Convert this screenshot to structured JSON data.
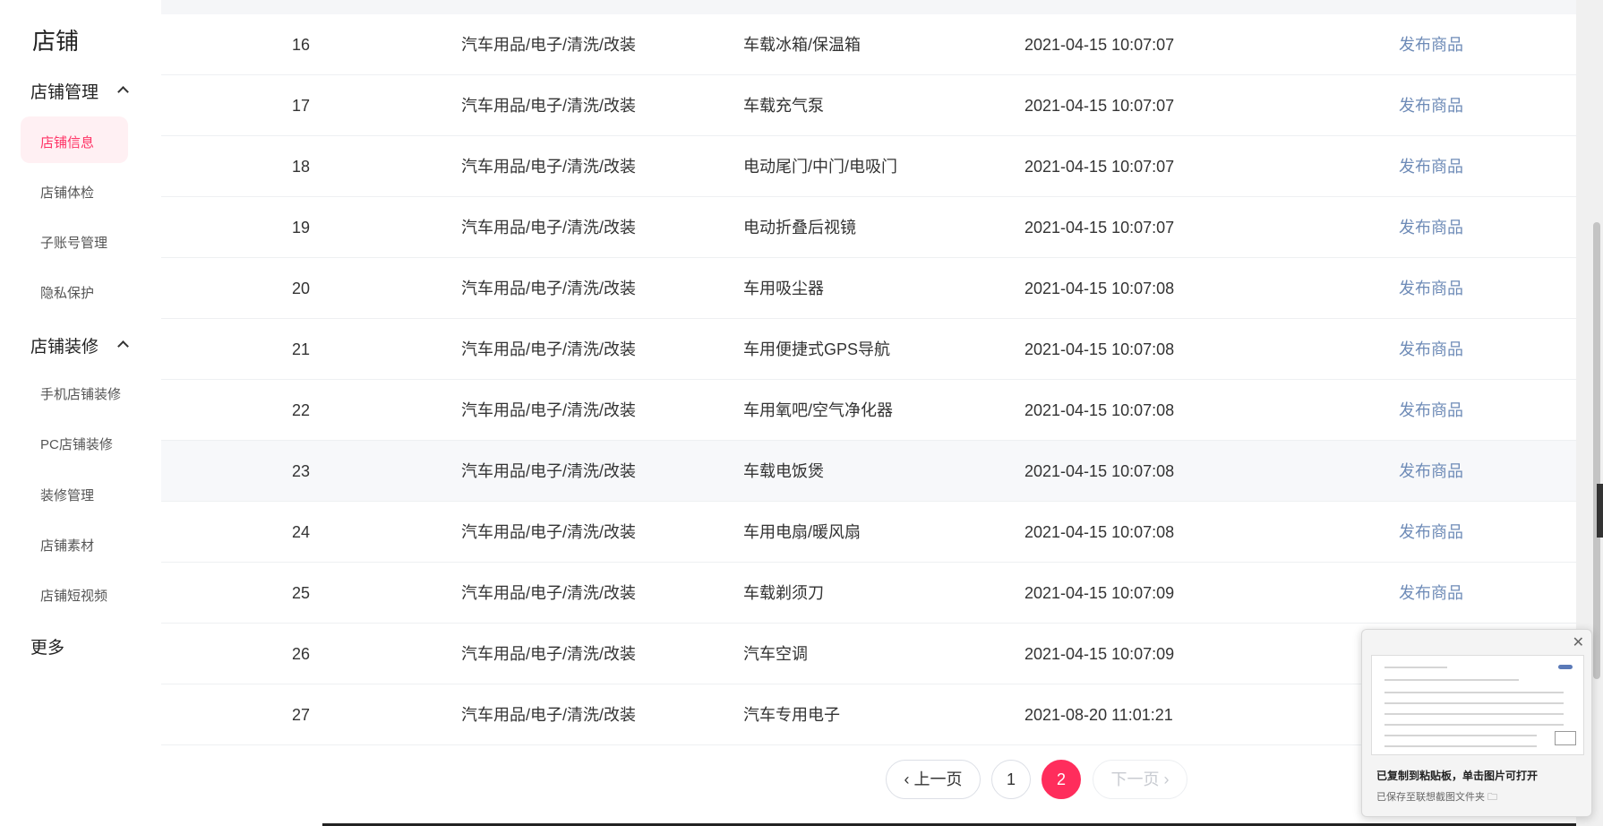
{
  "sidebar": {
    "brand": "店铺",
    "groups": [
      {
        "title": "店铺管理",
        "items": [
          "店铺信息",
          "店铺体检",
          "子账号管理",
          "隐私保护"
        ]
      },
      {
        "title": "店铺装修",
        "items": [
          "手机店铺装修",
          "PC店铺装修",
          "装修管理",
          "店铺素材",
          "店铺短视频"
        ]
      }
    ],
    "more": "更多",
    "active_item": "店铺信息"
  },
  "table": {
    "rows": [
      {
        "num": "16",
        "category": "汽车用品/电子/清洗/改装",
        "subcategory": "车载冰箱/保温箱",
        "time": "2021-04-15 10:07:07",
        "action": "发布商品"
      },
      {
        "num": "17",
        "category": "汽车用品/电子/清洗/改装",
        "subcategory": "车载充气泵",
        "time": "2021-04-15 10:07:07",
        "action": "发布商品"
      },
      {
        "num": "18",
        "category": "汽车用品/电子/清洗/改装",
        "subcategory": "电动尾门/中门/电吸门",
        "time": "2021-04-15 10:07:07",
        "action": "发布商品"
      },
      {
        "num": "19",
        "category": "汽车用品/电子/清洗/改装",
        "subcategory": "电动折叠后视镜",
        "time": "2021-04-15 10:07:07",
        "action": "发布商品"
      },
      {
        "num": "20",
        "category": "汽车用品/电子/清洗/改装",
        "subcategory": "车用吸尘器",
        "time": "2021-04-15 10:07:08",
        "action": "发布商品"
      },
      {
        "num": "21",
        "category": "汽车用品/电子/清洗/改装",
        "subcategory": "车用便捷式GPS导航",
        "time": "2021-04-15 10:07:08",
        "action": "发布商品"
      },
      {
        "num": "22",
        "category": "汽车用品/电子/清洗/改装",
        "subcategory": "车用氧吧/空气净化器",
        "time": "2021-04-15 10:07:08",
        "action": "发布商品"
      },
      {
        "num": "23",
        "category": "汽车用品/电子/清洗/改装",
        "subcategory": "车载电饭煲",
        "time": "2021-04-15 10:07:08",
        "action": "发布商品"
      },
      {
        "num": "24",
        "category": "汽车用品/电子/清洗/改装",
        "subcategory": "车用电扇/暖风扇",
        "time": "2021-04-15 10:07:08",
        "action": "发布商品"
      },
      {
        "num": "25",
        "category": "汽车用品/电子/清洗/改装",
        "subcategory": "车载剃须刀",
        "time": "2021-04-15 10:07:09",
        "action": "发布商品"
      },
      {
        "num": "26",
        "category": "汽车用品/电子/清洗/改装",
        "subcategory": "汽车空调",
        "time": "2021-04-15 10:07:09",
        "action": ""
      },
      {
        "num": "27",
        "category": "汽车用品/电子/清洗/改装",
        "subcategory": "汽车专用电子",
        "time": "2021-08-20 11:01:21",
        "action": ""
      }
    ],
    "highlighted_row": "23"
  },
  "pagination": {
    "prev": "‹ 上一页",
    "pages": [
      "1",
      "2"
    ],
    "current": "2",
    "next": "下一页 ›"
  },
  "toast": {
    "close": "✕",
    "title": "已复制到粘贴板，单击图片可打开",
    "subtitle": "已保存至联想截图文件夹 🗀"
  },
  "colors": {
    "accent": "#ff2d5c",
    "link": "#6e8bb7",
    "active_bg": "#fff0f3"
  }
}
